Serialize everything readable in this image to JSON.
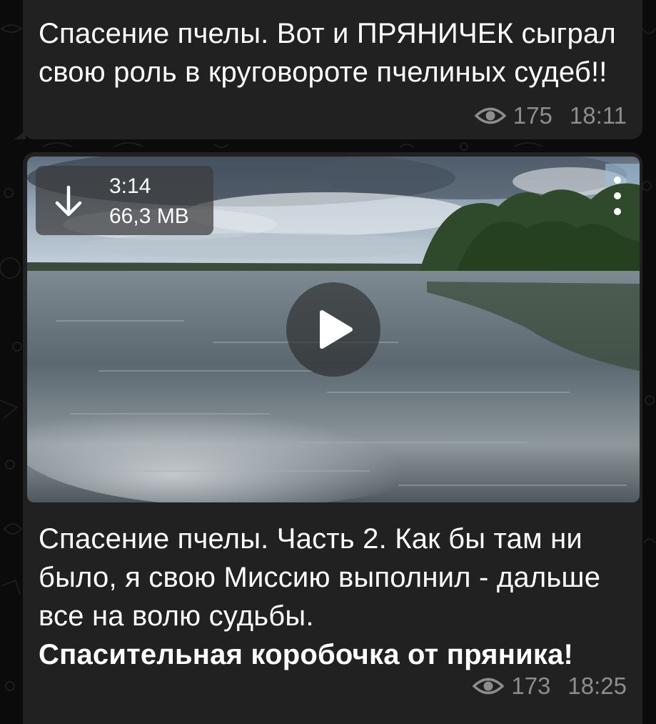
{
  "messages": [
    {
      "text": "Спасение пчелы. Вот и ПРЯНИЧЕК сыграл свою роль в круговороте пчелиных судеб!!",
      "views": "175",
      "time": "18:11"
    },
    {
      "video": {
        "duration": "3:14",
        "size": "66,3 MB"
      },
      "text": "Спасение пчелы. Часть 2. Как бы там ни было, я свою Миссию выполнил - дальше все на волю судьбы.",
      "bold_text": "Спасительная коробочка от пряника!",
      "views": "173",
      "time": "18:25"
    }
  ],
  "icons": {
    "views": "eye-icon",
    "download": "download-arrow-icon",
    "menu": "more-vertical-icon",
    "play": "play-icon"
  },
  "colors": {
    "background": "#0b0b0b",
    "bubble": "#212121",
    "meta_text": "#8d8d8d",
    "text": "#ffffff"
  }
}
